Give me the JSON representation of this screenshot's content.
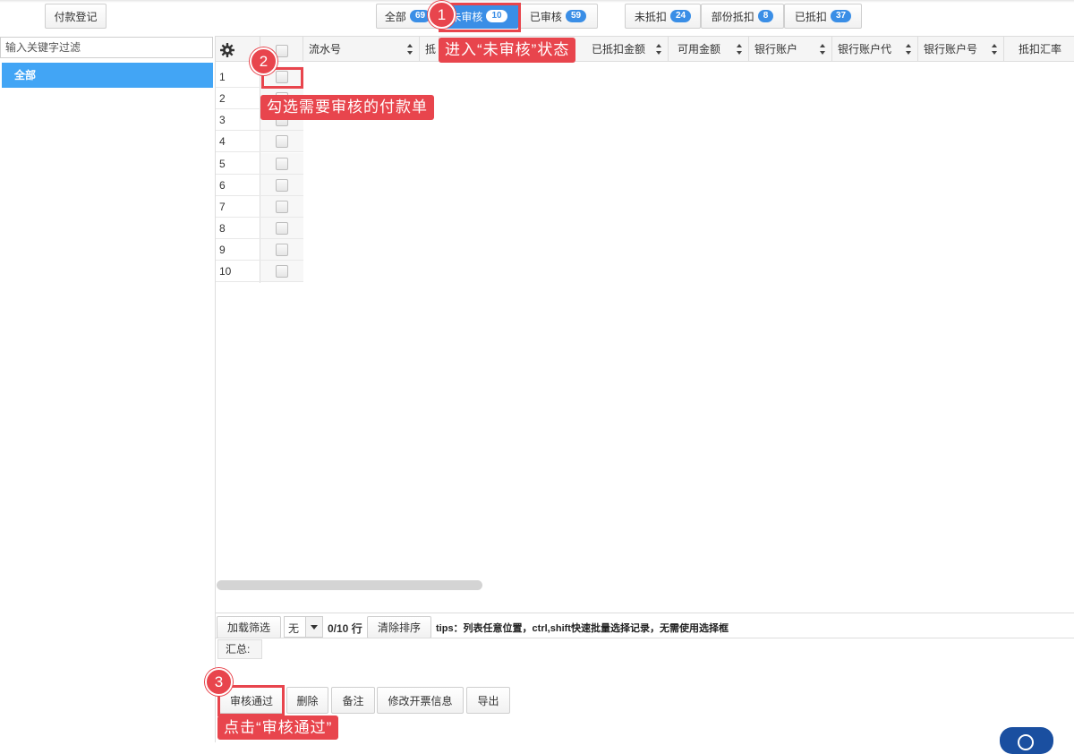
{
  "toolbar": {
    "register_label": "付款登记"
  },
  "status_tabs": [
    {
      "label": "全部",
      "count": "69"
    },
    {
      "label": "未审核",
      "count": "10"
    },
    {
      "label": "已审核",
      "count": "59"
    }
  ],
  "deduct_tabs": [
    {
      "label": "未抵扣",
      "count": "24"
    },
    {
      "label": "部份抵扣",
      "count": "8"
    },
    {
      "label": "已抵扣",
      "count": "37"
    }
  ],
  "sidebar": {
    "filter_placeholder": "输入关键字过滤",
    "tree_root": "全部"
  },
  "grid": {
    "columns": [
      "流水号",
      "抵",
      "已抵扣金额",
      "可用金额",
      "银行账户",
      "银行账户代",
      "银行账户号",
      "抵扣汇率"
    ],
    "rows": [
      "1",
      "2",
      "3",
      "4",
      "5",
      "6",
      "7",
      "8",
      "9",
      "10"
    ]
  },
  "footer": {
    "load_filter_label": "加载筛选",
    "select_value": "无",
    "row_count": "0/10 行",
    "clear_sort_label": "清除排序",
    "tips": "tips：列表任意位置，ctrl,shift快速批量选择记录，无需使用选择框",
    "summary_label": "汇总:"
  },
  "actions": {
    "approve": "审核通过",
    "delete": "删除",
    "remark": "备注",
    "edit_invoice": "修改开票信息",
    "export": "导出"
  },
  "annotations": {
    "step1_num": "1",
    "step1_text": "进入“未审核”状态",
    "step2_num": "2",
    "step2_text": "勾选需要审核的付款单",
    "step3_num": "3",
    "step3_text": "点击“审核通过”"
  },
  "colors": {
    "accent": "#3a8ee6",
    "tree_selected": "#42a5f5",
    "annotation": "#e8454d"
  }
}
